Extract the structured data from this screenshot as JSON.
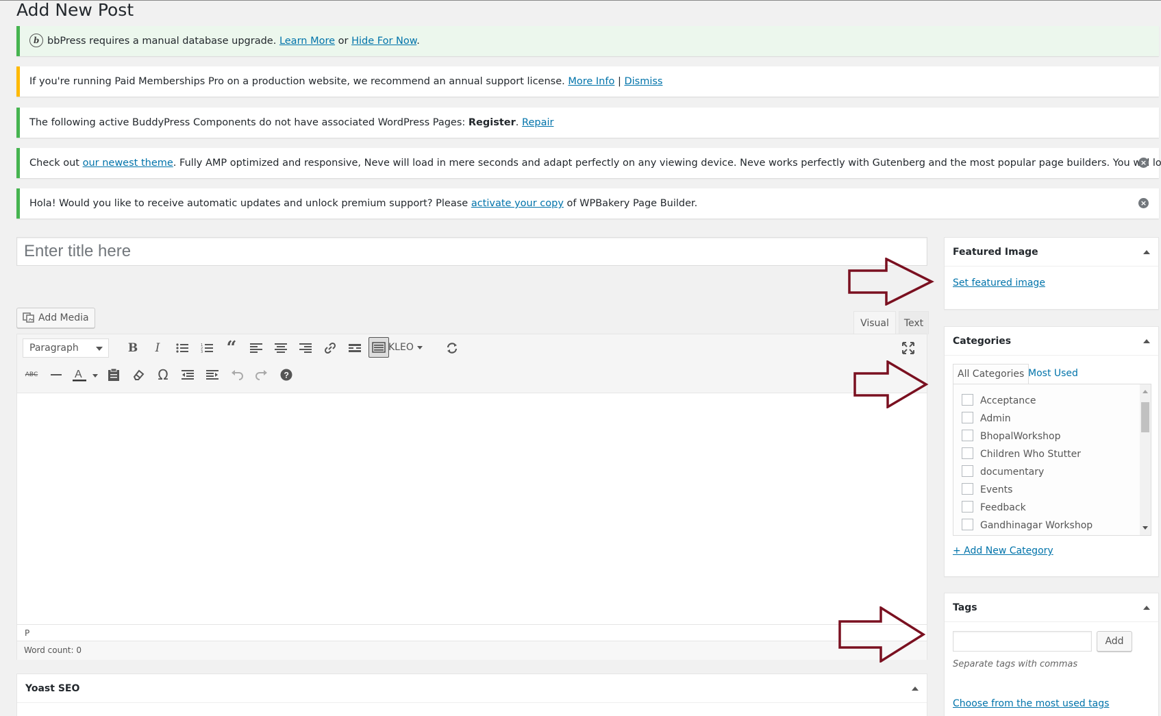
{
  "page": {
    "title": "Add New Post"
  },
  "notices": [
    {
      "text_before": "bbPress requires a manual database upgrade. ",
      "link1": "Learn More",
      "middle": " or ",
      "link2": "Hide For Now",
      "after": "."
    },
    {
      "text_before": "If you're running Paid Memberships Pro on a production website, we recommend an annual support license. ",
      "link1": "More Info",
      "middle": " | ",
      "link2": "Dismiss"
    },
    {
      "text_before": "The following active BuddyPress Components do not have associated WordPress Pages: ",
      "bold": "Register",
      "middle": ". ",
      "link1": "Repair"
    },
    {
      "text_before": "Check out ",
      "link1": "our newest theme",
      "after": ". Fully AMP optimized and responsive, Neve will load in mere seconds and adapt perfectly on any viewing device. Neve works perfectly with Gutenberg and the most popular page builders. You will love it!"
    },
    {
      "text_before": "Hola! Would you like to receive automatic updates and unlock premium support? Please ",
      "link1": "activate your copy",
      "after": " of WPBakery Page Builder."
    }
  ],
  "title_field": {
    "placeholder": "Enter title here",
    "value": ""
  },
  "media": {
    "add_media_label": "Add Media"
  },
  "editor": {
    "tabs": [
      "Visual",
      "Text"
    ],
    "active_tab": "Visual",
    "format_select": "Paragraph",
    "kleo_label": "KLEO",
    "path": "P",
    "word_count": "Word count: 0",
    "toolbar_row1_icons": [
      "bold-icon",
      "italic-icon",
      "bulleted-list-icon",
      "numbered-list-icon",
      "blockquote-icon",
      "align-left-icon",
      "align-center-icon",
      "align-right-icon",
      "link-icon",
      "read-more-icon",
      "toolbar-toggle-icon",
      "kleo-dropdown",
      "refresh-icon",
      "fullscreen-icon"
    ],
    "toolbar_row2_icons": [
      "strikethrough-icon",
      "horizontal-line-icon",
      "text-color-icon",
      "paste-text-icon",
      "clear-formatting-icon",
      "special-character-icon",
      "outdent-icon",
      "indent-icon",
      "undo-icon",
      "redo-icon",
      "help-icon"
    ]
  },
  "yoast": {
    "title": "Yoast SEO"
  },
  "featured_image": {
    "title": "Featured Image",
    "link": "Set featured image"
  },
  "categories": {
    "title": "Categories",
    "tabs": [
      "All Categories",
      "Most Used"
    ],
    "items": [
      "Acceptance",
      "Admin",
      "BhopalWorkshop",
      "Children Who Stutter",
      "documentary",
      "Events",
      "Feedback",
      "Gandhinagar Workshop"
    ],
    "add_link": "+ Add New Category"
  },
  "tags": {
    "title": "Tags",
    "input_value": "",
    "add_button": "Add",
    "hint": "Separate tags with commas",
    "choose_link": "Choose from the most used tags"
  },
  "colors": {
    "link": "#0073aa",
    "arrow": "#7a1020",
    "notice_green": "#46b450",
    "notice_yellow": "#ffb900"
  }
}
